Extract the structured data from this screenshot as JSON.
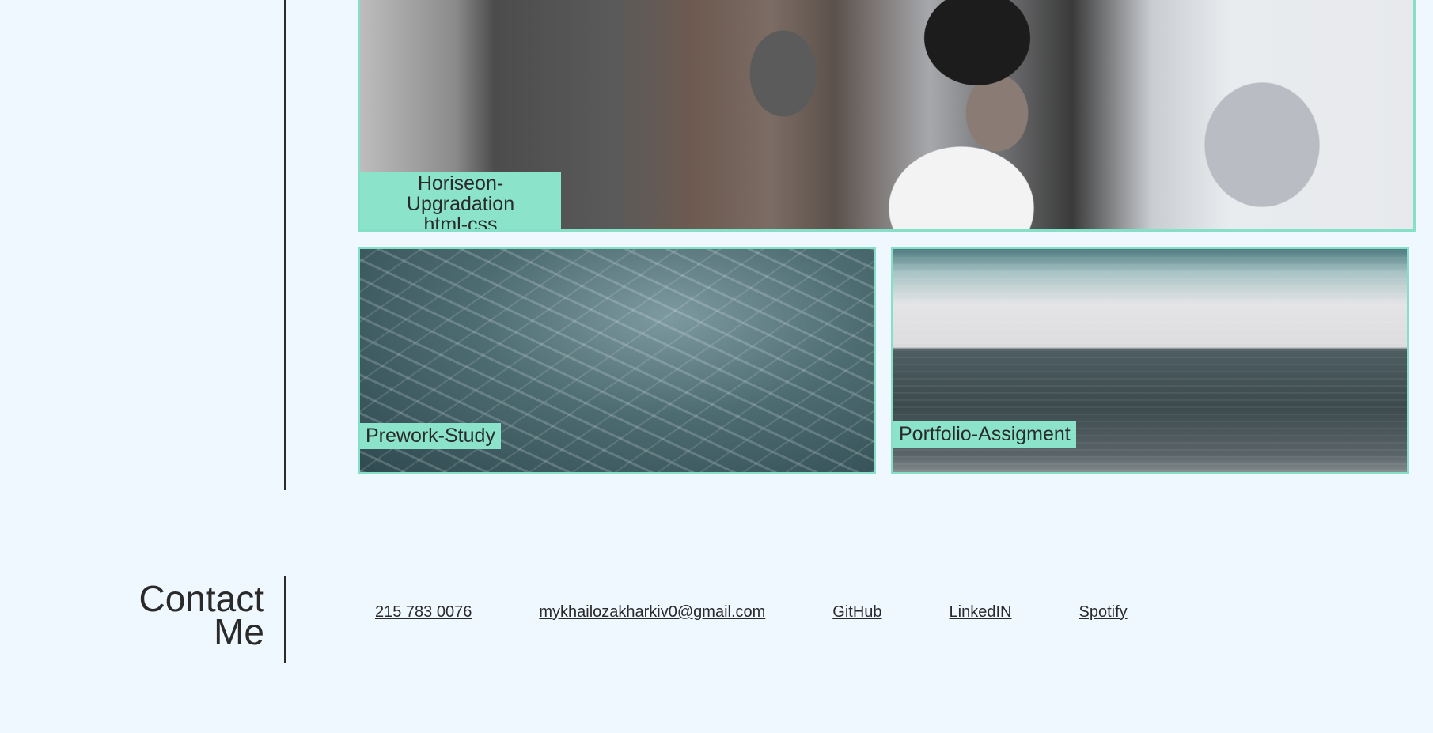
{
  "projects": [
    {
      "title_line1": "Horiseon-Upgradation",
      "title_line2": "html-css"
    },
    {
      "title": "Prework-Study"
    },
    {
      "title": "Portfolio-Assigment"
    }
  ],
  "contact": {
    "heading_line1": "Contact",
    "heading_line2": "Me",
    "phone": "215 783 0076",
    "email": "mykhailozakharkiv0@gmail.com",
    "github": "GitHub",
    "linkedin": "LinkedIN",
    "spotify": "Spotify"
  },
  "colors": {
    "background": "#f0f8ff",
    "accent": "#8be3c9",
    "text": "#2a2a2a"
  }
}
